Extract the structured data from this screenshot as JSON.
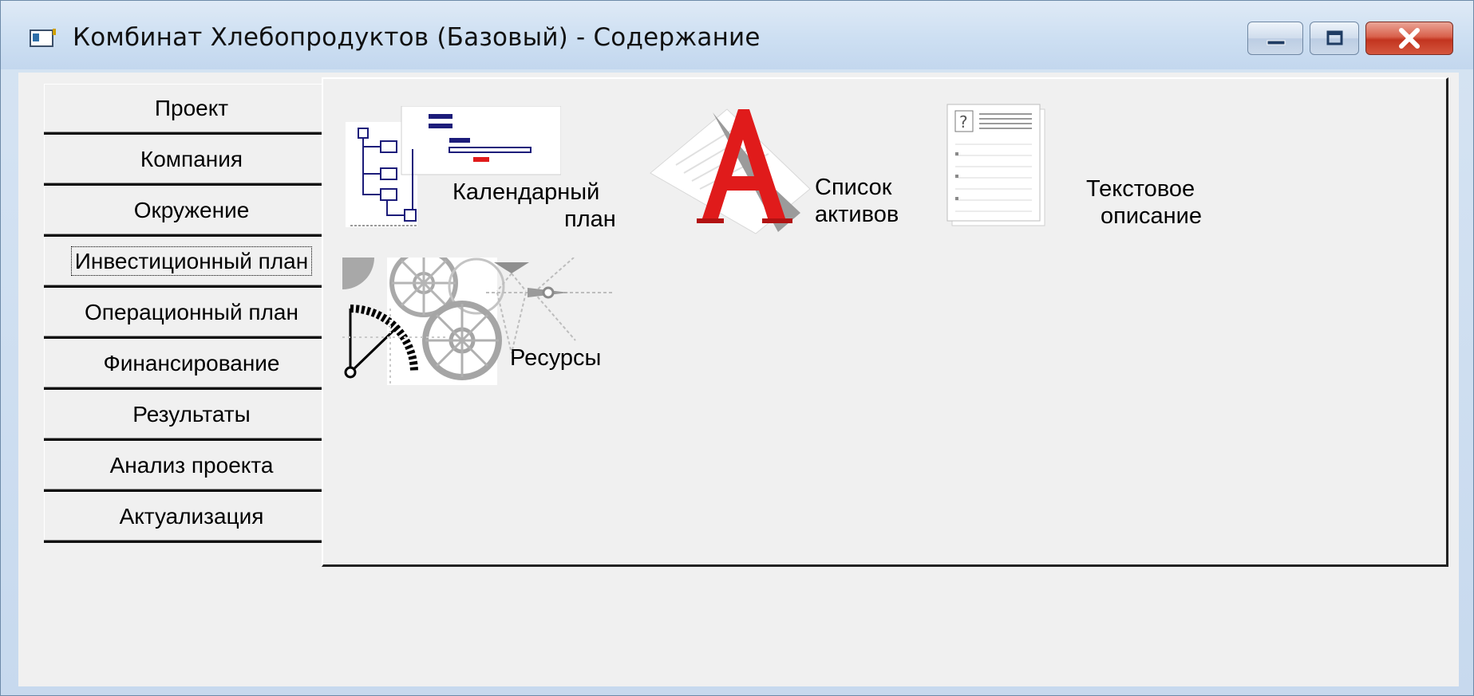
{
  "window": {
    "title": "Комбинат Хлебопродуктов (Базовый) - Содержание",
    "controls": [
      "minimize",
      "maximize",
      "close"
    ]
  },
  "tabs": {
    "items": [
      {
        "label": "Проект"
      },
      {
        "label": "Компания"
      },
      {
        "label": "Окружение"
      },
      {
        "label": "Инвестиционный план",
        "active": true
      },
      {
        "label": "Операционный план"
      },
      {
        "label": "Финансирование"
      },
      {
        "label": "Результаты"
      },
      {
        "label": "Анализ проекта"
      },
      {
        "label": "Актуализация"
      }
    ]
  },
  "panel": {
    "items": [
      {
        "label_line1": "Календарный",
        "label_line2": "план",
        "icon": "gantt-calendar-icon"
      },
      {
        "label_line1": "Список",
        "label_line2": "активов",
        "icon": "assets-letter-a-icon"
      },
      {
        "label_line1": "Текстовое",
        "label_line2": "описание",
        "icon": "text-document-icon"
      },
      {
        "label_line1": "Ресурсы",
        "label_line2": "",
        "icon": "gears-resources-icon"
      }
    ]
  },
  "colors": {
    "accent_red": "#e01b1b",
    "gantt_navy": "#1c1c7a",
    "close_red": "#c2341f"
  }
}
